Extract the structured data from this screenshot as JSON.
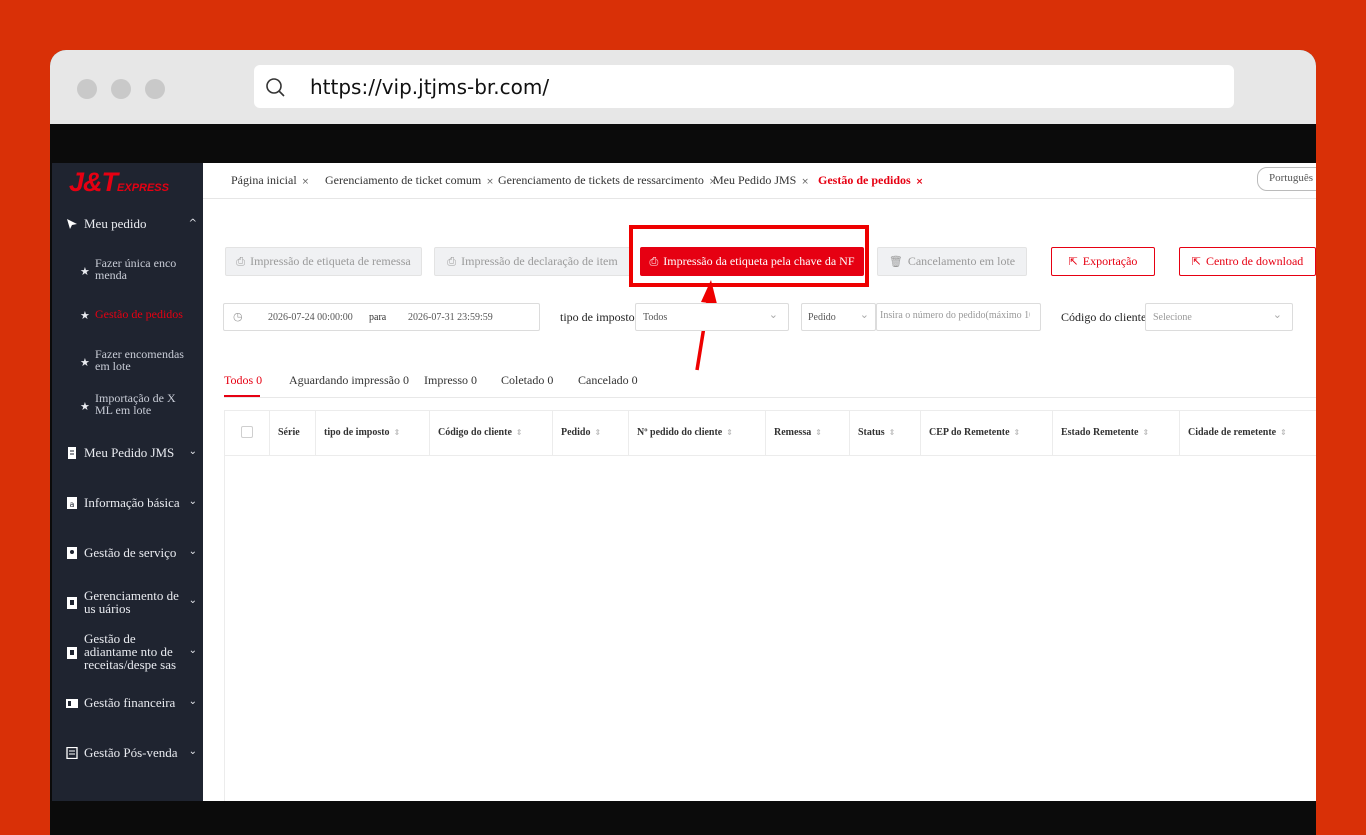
{
  "browser": {
    "url": "https://vip.jtjms-br.com/",
    "icons": {
      "search": "search-icon"
    }
  },
  "brand": {
    "logo_main": "J&T",
    "logo_sub": "EXPRESS",
    "accent": "#e60012"
  },
  "sidebar": {
    "items": [
      {
        "label": "Meu pedido",
        "icon": "cursor-icon",
        "chevron": "^"
      },
      {
        "label": "Meu Pedido JMS",
        "icon": "document-icon",
        "chevron": "⌄"
      },
      {
        "label": "Informação básica",
        "icon": "info-icon",
        "chevron": "⌄"
      },
      {
        "label": "Gestão de serviço",
        "icon": "service-icon",
        "chevron": "⌄"
      },
      {
        "label": "Gerenciamento de us uários",
        "icon": "users-icon",
        "chevron": "⌄"
      },
      {
        "label": "Gestão de adiantame nto de receitas/despe sas",
        "icon": "finance-advance-icon",
        "chevron": "⌄"
      },
      {
        "label": "Gestão financeira",
        "icon": "finance-icon",
        "chevron": "⌄"
      },
      {
        "label": "Gestão Pós-venda",
        "icon": "after-sales-icon",
        "chevron": "⌄"
      }
    ],
    "sub_items": [
      {
        "label": "Fazer única enco menda"
      },
      {
        "label": "Gestão de pedidos"
      },
      {
        "label": "Fazer encomendas em lote"
      },
      {
        "label": "Importação de X ML em lote"
      }
    ]
  },
  "tabs": [
    {
      "label": "Página inicial"
    },
    {
      "label": "Gerenciamento de ticket comum"
    },
    {
      "label": "Gerenciamento de tickets de ressarcimento"
    },
    {
      "label": "Meu Pedido JMS"
    },
    {
      "label": "Gestão de pedidos"
    }
  ],
  "tab_close": "×",
  "language": "Português",
  "actions": {
    "print_shipping_label": "Impressão de etiqueta de remessa",
    "print_item_declaration": "Impressão de declaração de item",
    "print_label_by_nf_key": "Impressão da etiqueta pela chave da NF",
    "batch_cancel": "Cancelamento em lote",
    "export": "Exportação",
    "download_center": "Centro de download"
  },
  "filters": {
    "date_start": "2026-07-24 00:00:00",
    "date_sep": "para",
    "date_end": "2026-07-31 23:59:59",
    "tax_type_label": "tipo de imposto",
    "tax_type_value": "Todos",
    "order_select": "Pedido",
    "order_input_placeholder": "Insira o número do pedido(máximo 10",
    "client_code_label": "Código do cliente",
    "client_code_placeholder": "Selecione"
  },
  "status_tabs": [
    {
      "label": "Todos 0"
    },
    {
      "label": "Aguardando impressão 0"
    },
    {
      "label": "Impresso 0"
    },
    {
      "label": "Coletado 0"
    },
    {
      "label": "Cancelado 0"
    }
  ],
  "table": {
    "columns": [
      "Série",
      "tipo de imposto",
      "Código do cliente",
      "Pedido",
      "Nº pedido do cliente",
      "Remessa",
      "Status",
      "CEP do Remetente",
      "Estado Remetente",
      "Cidade de remetente"
    ],
    "sort_glyph": "⇕"
  },
  "colors": {
    "background": "#d93007",
    "sidebar": "#1f2430",
    "highlight": "#ee0000"
  }
}
